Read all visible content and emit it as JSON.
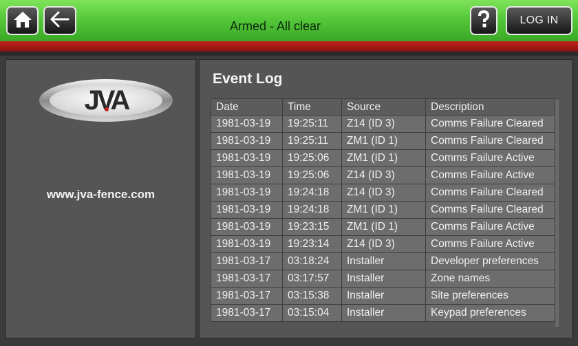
{
  "header": {
    "status_text": "Armed - All clear",
    "home_icon": "home-icon",
    "back_icon": "back-arrow-icon",
    "help_icon": "help-question-icon",
    "login_label": "LOG IN"
  },
  "sidebar": {
    "logo_text": "JVA",
    "website": "www.jva-fence.com"
  },
  "event_log": {
    "title": "Event Log",
    "columns": [
      "Date",
      "Time",
      "Source",
      "Description"
    ],
    "rows": [
      [
        "1981-03-19",
        "19:25:11",
        "Z14 (ID 3)",
        "Comms Failure Cleared"
      ],
      [
        "1981-03-19",
        "19:25:11",
        "ZM1 (ID 1)",
        "Comms Failure Cleared"
      ],
      [
        "1981-03-19",
        "19:25:06",
        "ZM1 (ID 1)",
        "Comms Failure Active"
      ],
      [
        "1981-03-19",
        "19:25:06",
        "Z14 (ID 3)",
        "Comms Failure Active"
      ],
      [
        "1981-03-19",
        "19:24:18",
        "Z14 (ID 3)",
        "Comms Failure Cleared"
      ],
      [
        "1981-03-19",
        "19:24:18",
        "ZM1 (ID 1)",
        "Comms Failure Cleared"
      ],
      [
        "1981-03-19",
        "19:23:15",
        "ZM1 (ID 1)",
        "Comms Failure Active"
      ],
      [
        "1981-03-19",
        "19:23:14",
        "Z14 (ID 3)",
        "Comms Failure Active"
      ],
      [
        "1981-03-17",
        "03:18:24",
        "Installer",
        "Developer preferences"
      ],
      [
        "1981-03-17",
        "03:17:57",
        "Installer",
        "Zone names"
      ],
      [
        "1981-03-17",
        "03:15:38",
        "Installer",
        "Site preferences"
      ],
      [
        "1981-03-17",
        "03:15:04",
        "Installer",
        "Keypad preferences"
      ]
    ]
  },
  "colors": {
    "header_green": "#55c93a",
    "alert_red": "#c0221c",
    "panel_gray": "#555555",
    "row_gray": "#6d6d6d"
  }
}
